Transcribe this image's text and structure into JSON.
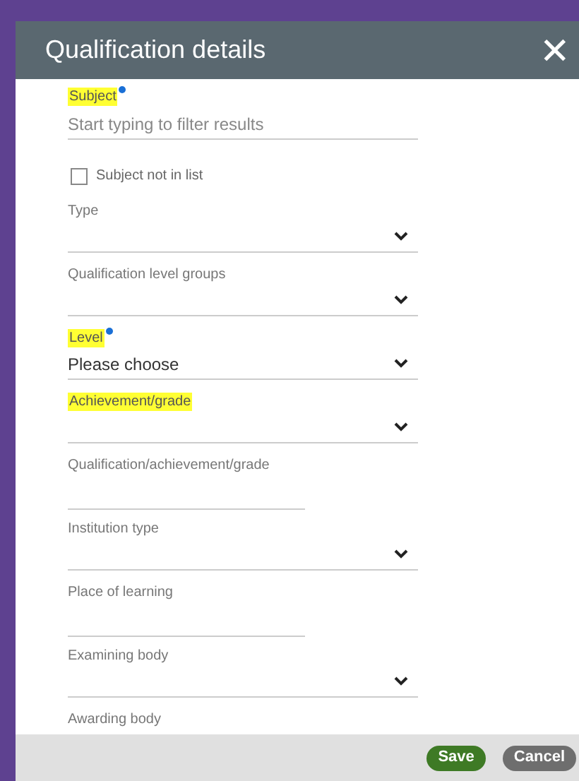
{
  "dialog": {
    "title": "Qualification details",
    "close": "✕"
  },
  "fields": [
    {
      "kind": "autocomplete",
      "label": "Subject",
      "highlighted": true,
      "required": true,
      "placeholder": "Start typing to filter results"
    },
    {
      "kind": "checkbox",
      "label": "Subject not in list",
      "checked": false
    },
    {
      "kind": "select",
      "label": "Type",
      "highlighted": false,
      "required": false
    },
    {
      "kind": "select",
      "label": "Qualification level groups",
      "highlighted": false,
      "required": false
    },
    {
      "kind": "select",
      "label": "Level",
      "highlighted": true,
      "required": true,
      "value": "Please choose"
    },
    {
      "kind": "select",
      "label": "Achievement/grade",
      "highlighted": true,
      "required": false
    },
    {
      "kind": "text",
      "label": "Qualification/achievement/grade",
      "highlighted": false,
      "required": false
    },
    {
      "kind": "select",
      "label": "Institution type",
      "highlighted": false,
      "required": false
    },
    {
      "kind": "text",
      "label": "Place of learning",
      "highlighted": false,
      "required": false
    },
    {
      "kind": "select",
      "label": "Examining body",
      "highlighted": false,
      "required": false
    },
    {
      "kind": "cut",
      "label": "Awarding body",
      "highlighted": false,
      "required": false
    }
  ],
  "buttons": [
    {
      "label": "Save",
      "kind": "primary"
    },
    {
      "label": "Cancel",
      "kind": "secondary"
    }
  ]
}
